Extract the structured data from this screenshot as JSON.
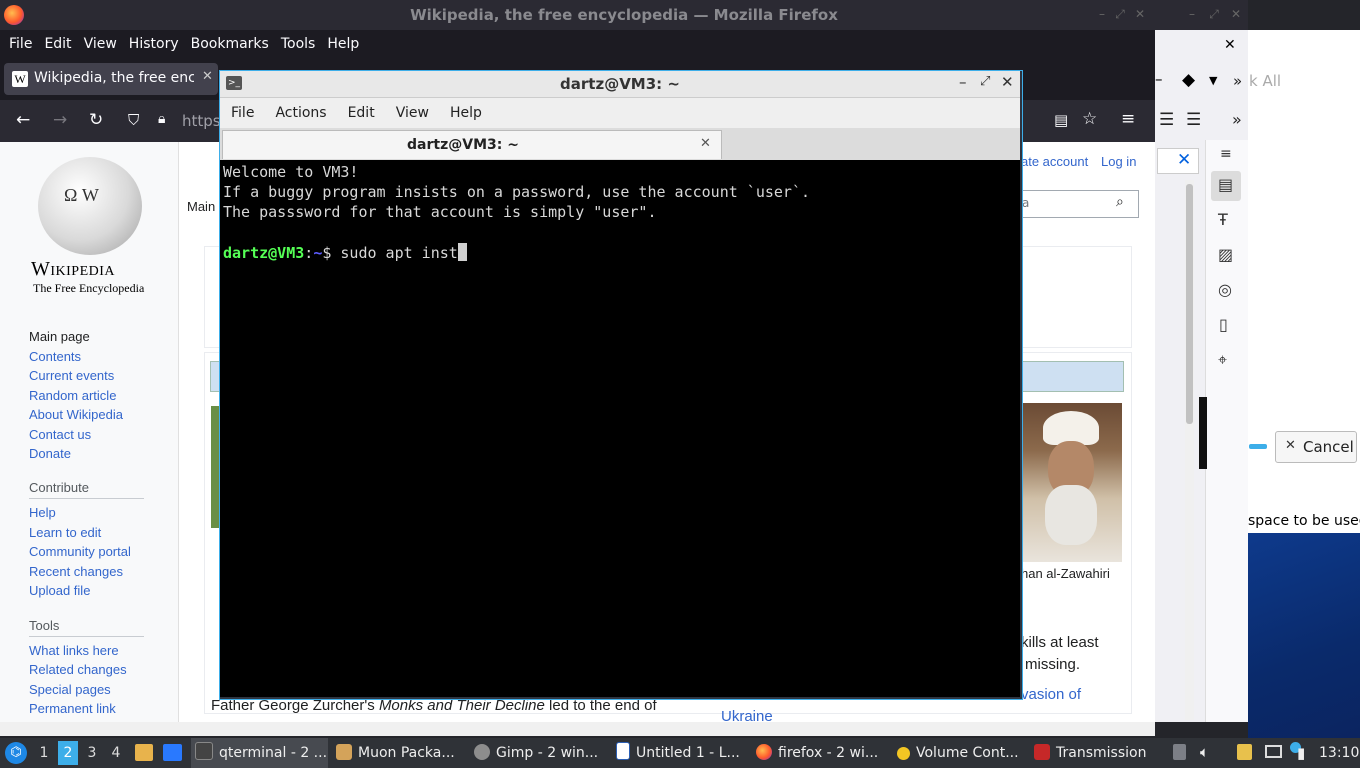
{
  "firefox": {
    "window_title": "Wikipedia, the free encyclopedia — Mozilla Firefox",
    "menu": [
      "File",
      "Edit",
      "View",
      "History",
      "Bookmarks",
      "Tools",
      "Help"
    ],
    "tab_title": "Wikipedia, the free encyclopedia",
    "url_prefix": "https"
  },
  "wikipedia": {
    "logo_wordmark": "Wikipedia",
    "tagline": "The Free Encyclopedia",
    "main_tab": "Main",
    "create_account": "ate account",
    "log_in": "Log in",
    "search_placeholder": "a",
    "nav": [
      "Main page",
      "Contents",
      "Current events",
      "Random article",
      "About Wikipedia",
      "Contact us",
      "Donate"
    ],
    "contribute_heading": "Contribute",
    "contribute": [
      "Help",
      "Learn to edit",
      "Community portal",
      "Recent changes",
      "Upload file"
    ],
    "tools_heading": "Tools",
    "tools": [
      "What links here",
      "Related changes",
      "Special pages",
      "Permanent link"
    ],
    "caption": "han al-Zawahiri",
    "snippet1": "kills at least",
    "snippet2": "missing.",
    "snippet3": "vasion of",
    "snippet4": "Ukraine",
    "bottom_text_prefix": "Father George Zurcher's ",
    "bottom_text_italic": "Monks and Their Decline",
    "bottom_text_suffix": " led to the end of"
  },
  "right_panel": {
    "partial_label": "k All",
    "cancel": "Cancel",
    "space_text": "space to be used"
  },
  "terminal": {
    "title": "dartz@VM3: ~",
    "menu": [
      "File",
      "Actions",
      "Edit",
      "View",
      "Help"
    ],
    "tab_title": "dartz@VM3: ~",
    "lines": [
      "Welcome to VM3!",
      "If a buggy program insists on a password, use the account `user`.",
      "The passsword for that account is simply \"user\"."
    ],
    "prompt_user": "dartz@VM3",
    "prompt_sep": ":",
    "prompt_path": "~",
    "prompt_symbol": "$ ",
    "command": "sudo apt inst"
  },
  "taskbar": {
    "workspaces": [
      "1",
      "2",
      "3",
      "4"
    ],
    "active_workspace": "2",
    "items": [
      {
        "label": "qterminal - 2 ...",
        "icon": "terminal-icon"
      },
      {
        "label": "Muon Packa...",
        "icon": "package-icon"
      },
      {
        "label": "Gimp - 2 win...",
        "icon": "gimp-icon"
      },
      {
        "label": "Untitled 1 - L...",
        "icon": "document-icon"
      },
      {
        "label": "firefox - 2 wi...",
        "icon": "firefox-icon"
      },
      {
        "label": "Volume Cont...",
        "icon": "volume-control-icon"
      },
      {
        "label": "Transmission",
        "icon": "transmission-icon"
      }
    ],
    "clock": "13:10"
  }
}
